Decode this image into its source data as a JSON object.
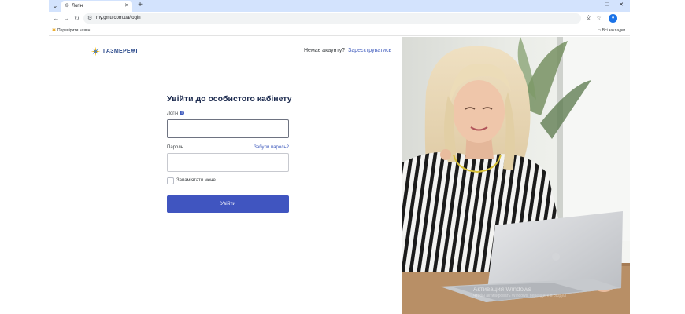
{
  "browser": {
    "tab_title": "Логін",
    "url": "my.gmu.com.ua/login",
    "bookmark_item": "Перевірити наявн...",
    "all_bookmarks": "Всі закладки"
  },
  "header": {
    "logo_text": "ГАЗМЕРЕЖІ",
    "no_account_text": "Немає акаунту?",
    "register_link": "Зареєструватись"
  },
  "form": {
    "title": "Увійти до особистого кабінету",
    "login_label": "Логін",
    "login_value": "",
    "password_label": "Пароль",
    "password_value": "",
    "forgot_link": "Забули пароль?",
    "remember_label": "Запам'ятати мене",
    "remember_checked": false,
    "submit_label": "Увійти"
  },
  "watermark": {
    "title": "Активация Windows",
    "subtitle": "Чтобы активировать Windows, перейдите в раздел"
  },
  "colors": {
    "accent": "#4055c0",
    "link": "#3f5bbd",
    "title": "#1d2b4f",
    "logo": "#2b4a8b",
    "tabstrip": "#d3e3fd"
  },
  "icons": {
    "tab_menu": "chevron-down-icon",
    "favicon": "page-favicon-icon",
    "tab_close": "close-icon",
    "new_tab": "plus-icon",
    "back": "back-arrow-icon",
    "forward": "forward-arrow-icon",
    "reload": "reload-icon",
    "site_info": "tune-icon",
    "translate": "translate-icon",
    "star": "star-icon",
    "profile": "profile-icon",
    "menu": "kebab-menu-icon",
    "folder": "folder-icon",
    "info": "info-icon"
  }
}
